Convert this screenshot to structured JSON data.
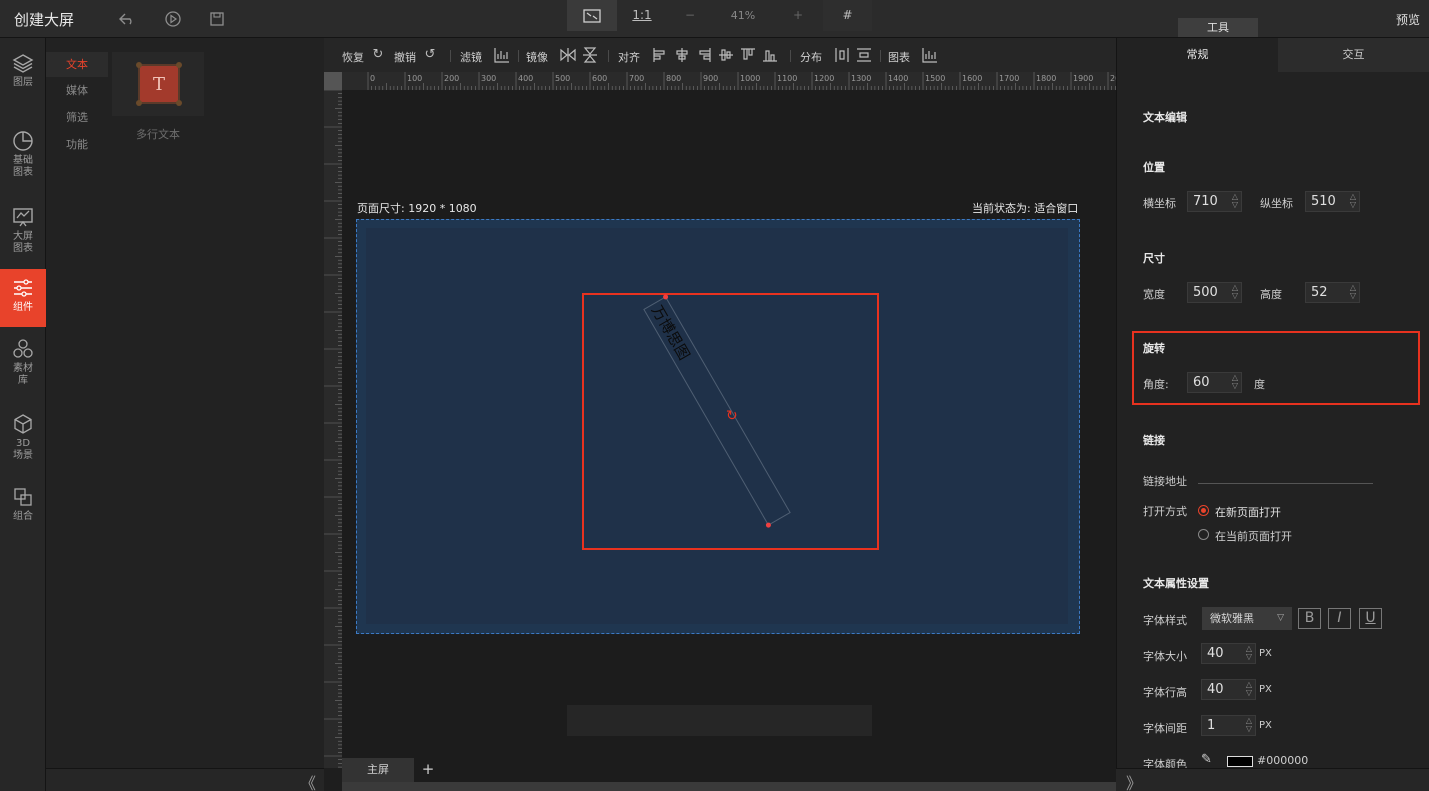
{
  "app": {
    "title": "创建大屏",
    "tools_tab": "工具",
    "preview": "预览"
  },
  "top_icons": [
    "undo-arrow-icon",
    "play-icon",
    "save-icon"
  ],
  "nav": {
    "items": [
      {
        "id": "layers",
        "label": "图层",
        "icon": "layers-icon"
      },
      {
        "id": "basic-chart",
        "label": "基础\n图表",
        "icon": "pie-chart-icon"
      },
      {
        "id": "bigscreen-chart",
        "label": "大屏\n图表",
        "icon": "monitor-chart-icon"
      },
      {
        "id": "components",
        "label": "组件",
        "icon": "sliders-icon",
        "active": true
      },
      {
        "id": "materials",
        "label": "素材\n库",
        "icon": "hexagons-icon"
      },
      {
        "id": "3d-scene",
        "label": "3D\n场景",
        "icon": "cube-icon"
      },
      {
        "id": "group",
        "label": "组合",
        "icon": "group-icon"
      }
    ]
  },
  "component_panel": {
    "subtabs": [
      "文本",
      "媒体",
      "筛选",
      "功能"
    ],
    "active_subtab": "文本",
    "widget": {
      "label": "多行文本",
      "thumb_glyph": "T"
    }
  },
  "toolbar": {
    "redo": "恢复",
    "undo": "撤销",
    "filter": "滤镜",
    "mirror": "镜像",
    "align": "对齐",
    "distribute": "分布",
    "chart": "图表"
  },
  "ruler": {
    "ticks": [
      "0",
      "100",
      "200",
      "300",
      "400",
      "500",
      "600",
      "700",
      "800",
      "900",
      "1000",
      "1100",
      "1200",
      "1300",
      "1400",
      "1500",
      "1600",
      "1700",
      "1800",
      "1900",
      "200"
    ]
  },
  "canvas": {
    "page_size": "页面尺寸: 1920 * 1080",
    "current_state": "当前状态为: 适合窗口",
    "element_text": "万博思图"
  },
  "zoombar": {
    "fit_glyph": "⤢",
    "one_to_one": "1:1",
    "minus": "−",
    "zoom": "41%",
    "plus": "+",
    "grid_glyph": "#"
  },
  "screen_tabs": {
    "main": "主屏",
    "add": "+"
  },
  "right_panel": {
    "tab_general": "常规",
    "tab_interact": "交互",
    "text_edit_title": "文本编辑",
    "position": {
      "title": "位置",
      "x_label": "横坐标",
      "x": "710",
      "y_label": "纵坐标",
      "y": "510"
    },
    "size": {
      "title": "尺寸",
      "w_label": "宽度",
      "w": "500",
      "h_label": "高度",
      "h": "52"
    },
    "rotation": {
      "title": "旋转",
      "angle_label": "角度:",
      "angle": "60",
      "unit": "度"
    },
    "link": {
      "title": "链接",
      "url_label": "链接地址",
      "open_label": "打开方式",
      "option_new": "在新页面打开",
      "option_current": "在当前页面打开"
    },
    "text_props": {
      "title": "文本属性设置",
      "font_style_label": "字体样式",
      "font_family": "微软雅黑",
      "bold": "B",
      "italic": "I",
      "underline": "U",
      "font_size_label": "字体大小",
      "font_size": "40",
      "line_height_label": "字体行高",
      "line_height": "40",
      "letter_spacing_label": "字体间距",
      "letter_spacing": "1",
      "unit": "PX",
      "color_label": "字体颜色",
      "color": "#000000"
    }
  },
  "colors": {
    "accent": "#e8432b",
    "highlight": "#e8321f",
    "screen_bg": "#1f3149"
  }
}
